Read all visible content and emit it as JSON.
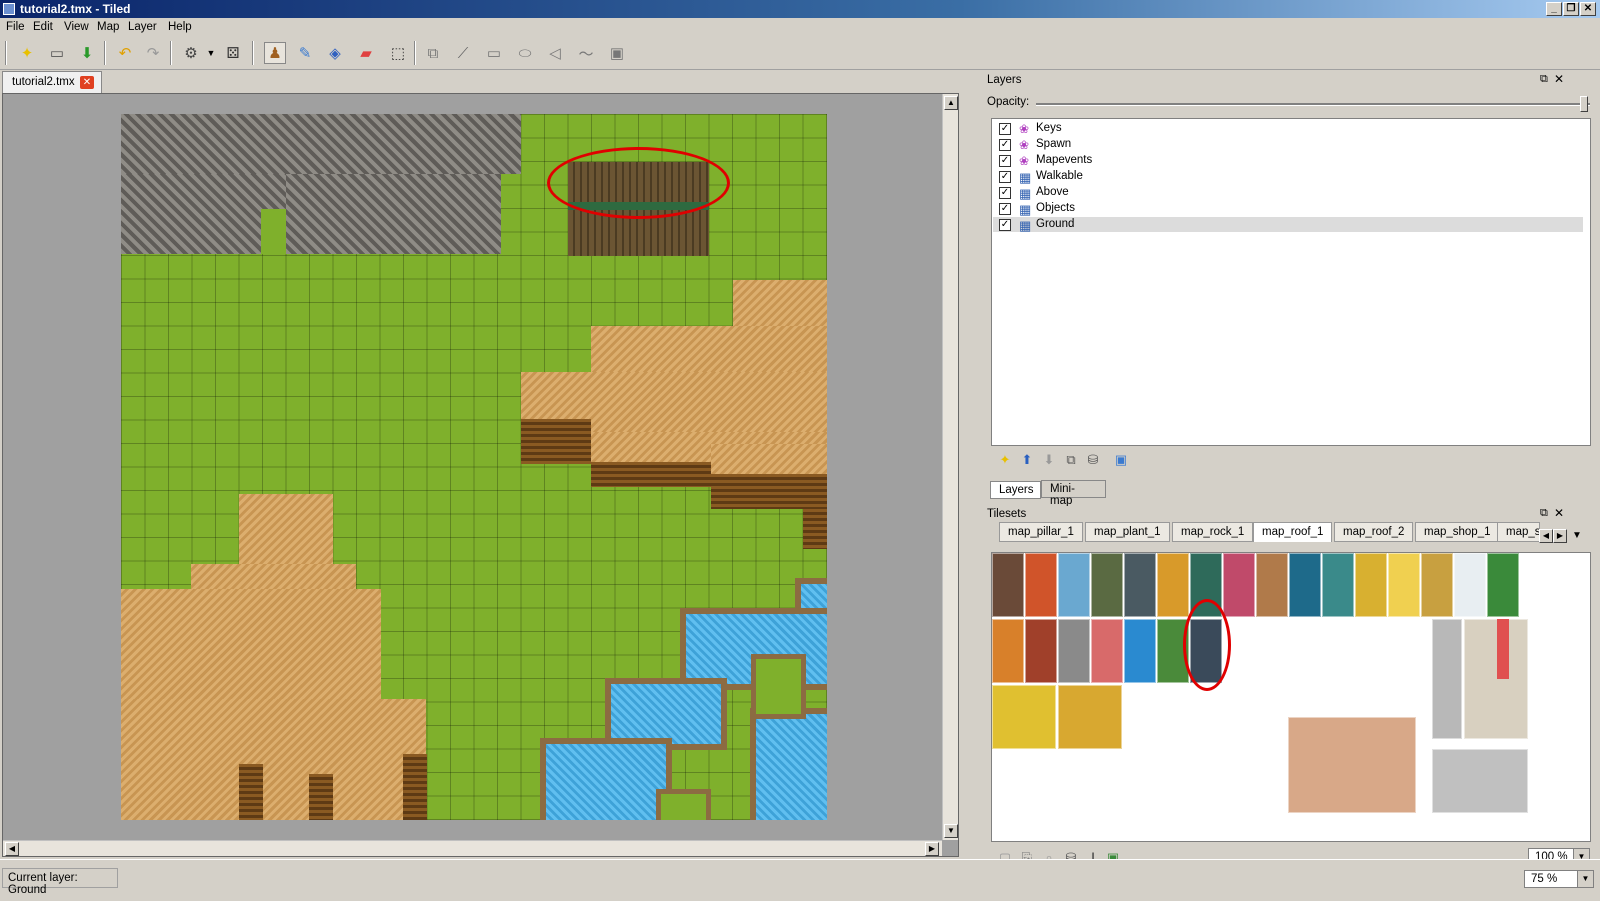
{
  "window": {
    "title": "tutorial2.tmx - Tiled",
    "btn_min": "_",
    "btn_max": "❐",
    "btn_close": "✕"
  },
  "menu": {
    "file": "File",
    "edit": "Edit",
    "view": "View",
    "map": "Map",
    "layer": "Layer",
    "help": "Help"
  },
  "toolbar_icons": [
    "new-icon",
    "open-icon",
    "save-icon",
    "undo-icon",
    "redo-icon",
    "stamp-random-icon",
    "dice-icon",
    "stamp-brush-icon",
    "terrain-brush-icon",
    "bucket-fill-icon",
    "eraser-icon",
    "rectangle-select-icon",
    "select-objects-icon",
    "edit-polygons-icon",
    "insert-rectangle-icon",
    "insert-ellipse-icon",
    "insert-polygon-icon",
    "insert-polyline-icon",
    "insert-tile-icon"
  ],
  "document_tab": {
    "label": "tutorial2.tmx",
    "close": "✕"
  },
  "layers_panel": {
    "title": "Layers",
    "opacity_label": "Opacity:",
    "opacity": 1.0,
    "layers": [
      {
        "name": "Keys",
        "type": "object",
        "checked": true
      },
      {
        "name": "Spawn",
        "type": "object",
        "checked": true
      },
      {
        "name": "Mapevents",
        "type": "object",
        "checked": true
      },
      {
        "name": "Walkable",
        "type": "tile",
        "checked": true
      },
      {
        "name": "Above",
        "type": "tile",
        "checked": true
      },
      {
        "name": "Objects",
        "type": "tile",
        "checked": true
      },
      {
        "name": "Ground",
        "type": "tile",
        "checked": true,
        "selected": true
      }
    ],
    "tabs": {
      "layers": "Layers",
      "minimap": "Mini-map"
    }
  },
  "tilesets_panel": {
    "title": "Tilesets",
    "tabs": [
      "map_pillar_1",
      "map_plant_1",
      "map_rock_1",
      "map_roof_1",
      "map_roof_2",
      "map_shop_1",
      "map_s"
    ],
    "selected_tab": "map_roof_1",
    "zoom": "100 %"
  },
  "status": {
    "current_layer": "Current layer: Ground",
    "zoom": "75 %"
  },
  "colors": {
    "highlight": "#e00000",
    "grass": "#7fb02c",
    "selected_row": "#dcdcdc"
  }
}
